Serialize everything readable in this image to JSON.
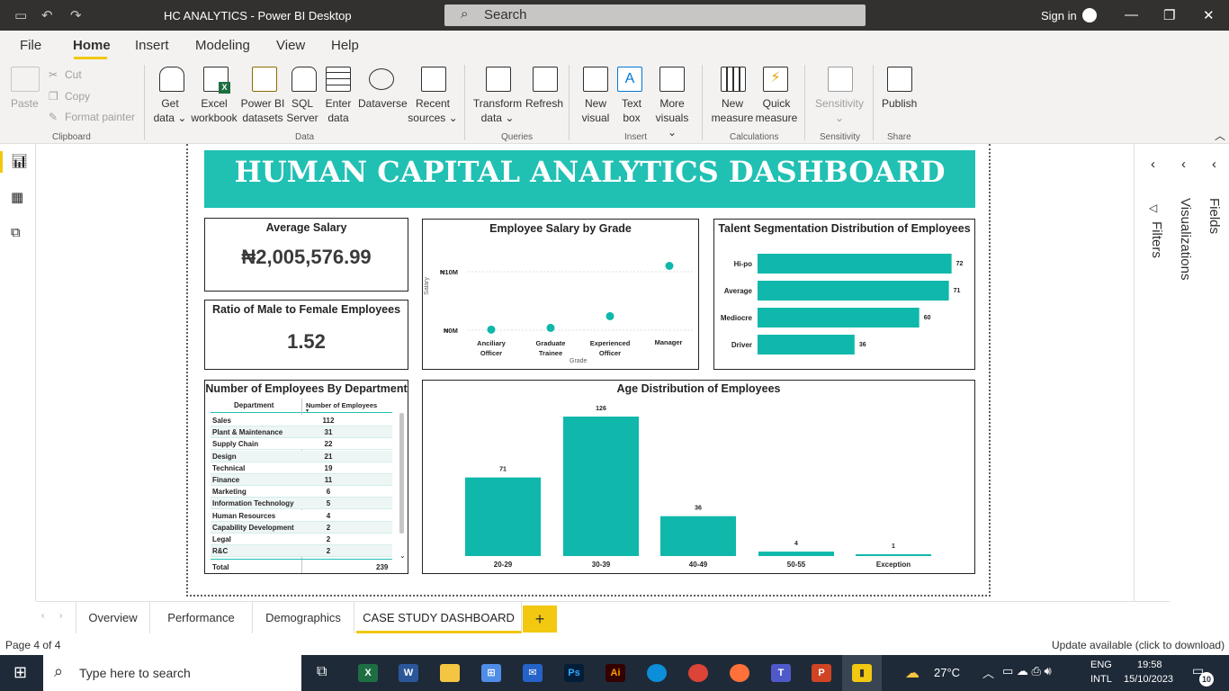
{
  "window": {
    "title": "HC ANALYTICS - Power BI Desktop",
    "search_placeholder": "Search",
    "sign_in": "Sign in"
  },
  "menu": [
    "File",
    "Home",
    "Insert",
    "Modeling",
    "View",
    "Help"
  ],
  "ribbon": {
    "clipboard": {
      "paste": "Paste",
      "cut": "Cut",
      "copy": "Copy",
      "format_painter": "Format painter",
      "group": "Clipboard"
    },
    "data": {
      "get_data_1": "Get",
      "get_data_2": "data",
      "excel_1": "Excel",
      "excel_2": "workbook",
      "pbi_1": "Power BI",
      "pbi_2": "datasets",
      "sql_1": "SQL",
      "sql_2": "Server",
      "enter_1": "Enter",
      "enter_2": "data",
      "dataverse": "Dataverse",
      "recent_1": "Recent",
      "recent_2": "sources",
      "group": "Data"
    },
    "queries": {
      "transform_1": "Transform",
      "transform_2": "data",
      "refresh": "Refresh",
      "group": "Queries"
    },
    "insert": {
      "newvisual_1": "New",
      "newvisual_2": "visual",
      "textbox_1": "Text",
      "textbox_2": "box",
      "more_1": "More",
      "more_2": "visuals",
      "group": "Insert"
    },
    "calculations": {
      "newmeasure_1": "New",
      "newmeasure_2": "measure",
      "quick_1": "Quick",
      "quick_2": "measure",
      "group": "Calculations"
    },
    "sensitivity": {
      "label": "Sensitivity",
      "group": "Sensitivity"
    },
    "share": {
      "publish": "Publish",
      "group": "Share"
    }
  },
  "panes": {
    "filters": "Filters",
    "visualizations": "Visualizations",
    "fields": "Fields"
  },
  "dashboard": {
    "title": "HUMAN CAPITAL ANALYTICS DASHBOARD",
    "avg_salary": {
      "title": "Average Salary",
      "value": "₦2,005,576.99"
    },
    "ratio": {
      "title": "Ratio of Male to Female Employees",
      "value": "1.52"
    },
    "salary_grade": {
      "title": "Employee Salary by Grade",
      "ylabel": "Salary",
      "xlabel": "Grade",
      "ytick_top": "₦10M",
      "ytick_bottom": "₦0M",
      "cat_1a": "Anciliary",
      "cat_1b": "Officer",
      "cat_2a": "Graduate",
      "cat_2b": "Trainee",
      "cat_3a": "Experienced",
      "cat_3b": "Officer",
      "cat_4": "Manager"
    },
    "talent": {
      "title": "Talent Segmentation Distribution of Employees"
    },
    "dept": {
      "title": "Number of Employees By Department",
      "col1": "Department",
      "col2": "Number of Employees",
      "total_label": "Total",
      "total_value": "239",
      "rows": [
        [
          "Sales",
          "112"
        ],
        [
          "Plant & Maintenance",
          "31"
        ],
        [
          "Supply Chain",
          "22"
        ],
        [
          "Design",
          "21"
        ],
        [
          "Technical",
          "19"
        ],
        [
          "Finance",
          "11"
        ],
        [
          "Marketing",
          "6"
        ],
        [
          "Information Technology",
          "5"
        ],
        [
          "Human Resources",
          "4"
        ],
        [
          "Capability Development",
          "2"
        ],
        [
          "Legal",
          "2"
        ],
        [
          "R&C",
          "2"
        ]
      ]
    },
    "age": {
      "title": "Age Distribution of Employees"
    }
  },
  "chart_data": [
    {
      "type": "scatter",
      "title": "Employee Salary by Grade",
      "xlabel": "Grade",
      "ylabel": "Salary",
      "categories": [
        "Anciliary Officer",
        "Graduate Trainee",
        "Experienced Officer",
        "Manager"
      ],
      "values": [
        0.1,
        0.4,
        2.4,
        11
      ],
      "ylim": [
        0,
        12
      ],
      "unit": "₦M"
    },
    {
      "type": "bar",
      "orientation": "horizontal",
      "title": "Talent Segmentation Distribution of Employees",
      "categories": [
        "Hi-po",
        "Average",
        "Mediocre",
        "Driver"
      ],
      "values": [
        72,
        71,
        60,
        36
      ],
      "xlim": [
        0,
        74
      ]
    },
    {
      "type": "bar",
      "title": "Age Distribution of Employees",
      "categories": [
        "20-29",
        "30-39",
        "40-49",
        "50-55",
        "Exception"
      ],
      "values": [
        71,
        126,
        36,
        4,
        1
      ],
      "ylim": [
        0,
        130
      ]
    }
  ],
  "tabs": [
    "Overview",
    "Performance",
    "Demographics",
    "CASE STUDY DASHBOARD"
  ],
  "status": {
    "page": "Page 4 of 4",
    "update": "Update available (click to download)"
  },
  "taskbar": {
    "search": "Type here to search",
    "temp": "27°C",
    "lang1": "ENG",
    "lang2": "INTL",
    "time": "19:58",
    "date": "15/10/2023",
    "notif": "10"
  },
  "colors": {
    "accent": "#20c0b3",
    "bar": "#0fb8aa",
    "tab_active": "#f2c811"
  }
}
